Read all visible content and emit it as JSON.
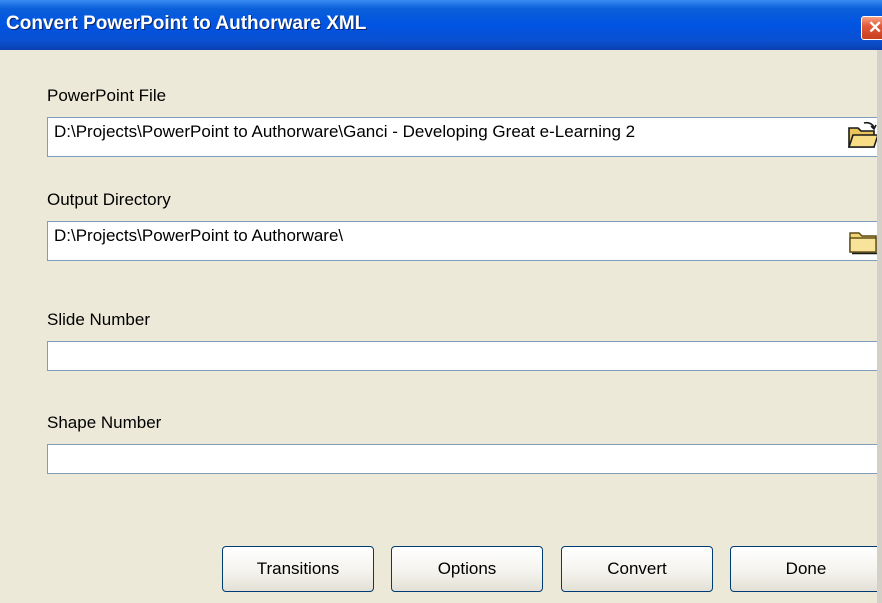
{
  "window": {
    "title": "Convert PowerPoint to Authorware XML",
    "close_glyph": "✕"
  },
  "form": {
    "powerpoint_file": {
      "label": "PowerPoint File",
      "value": "D:\\Projects\\PowerPoint to Authorware\\Ganci - Developing Great e-Learning 2",
      "button_icon": "open-folder-icon"
    },
    "output_directory": {
      "label": "Output Directory",
      "value": "D:\\Projects\\PowerPoint to Authorware\\",
      "button_icon": "folder-icon"
    },
    "slide_number": {
      "label": "Slide Number",
      "value": ""
    },
    "shape_number": {
      "label": "Shape Number",
      "value": ""
    }
  },
  "buttons": {
    "transitions": "Transitions",
    "options": "Options",
    "convert": "Convert",
    "done": "Done"
  },
  "colors": {
    "titlebar": "#0054e3",
    "window_bg": "#ece9d8",
    "close_button": "#e0593a",
    "field_border": "#7f9db9"
  }
}
